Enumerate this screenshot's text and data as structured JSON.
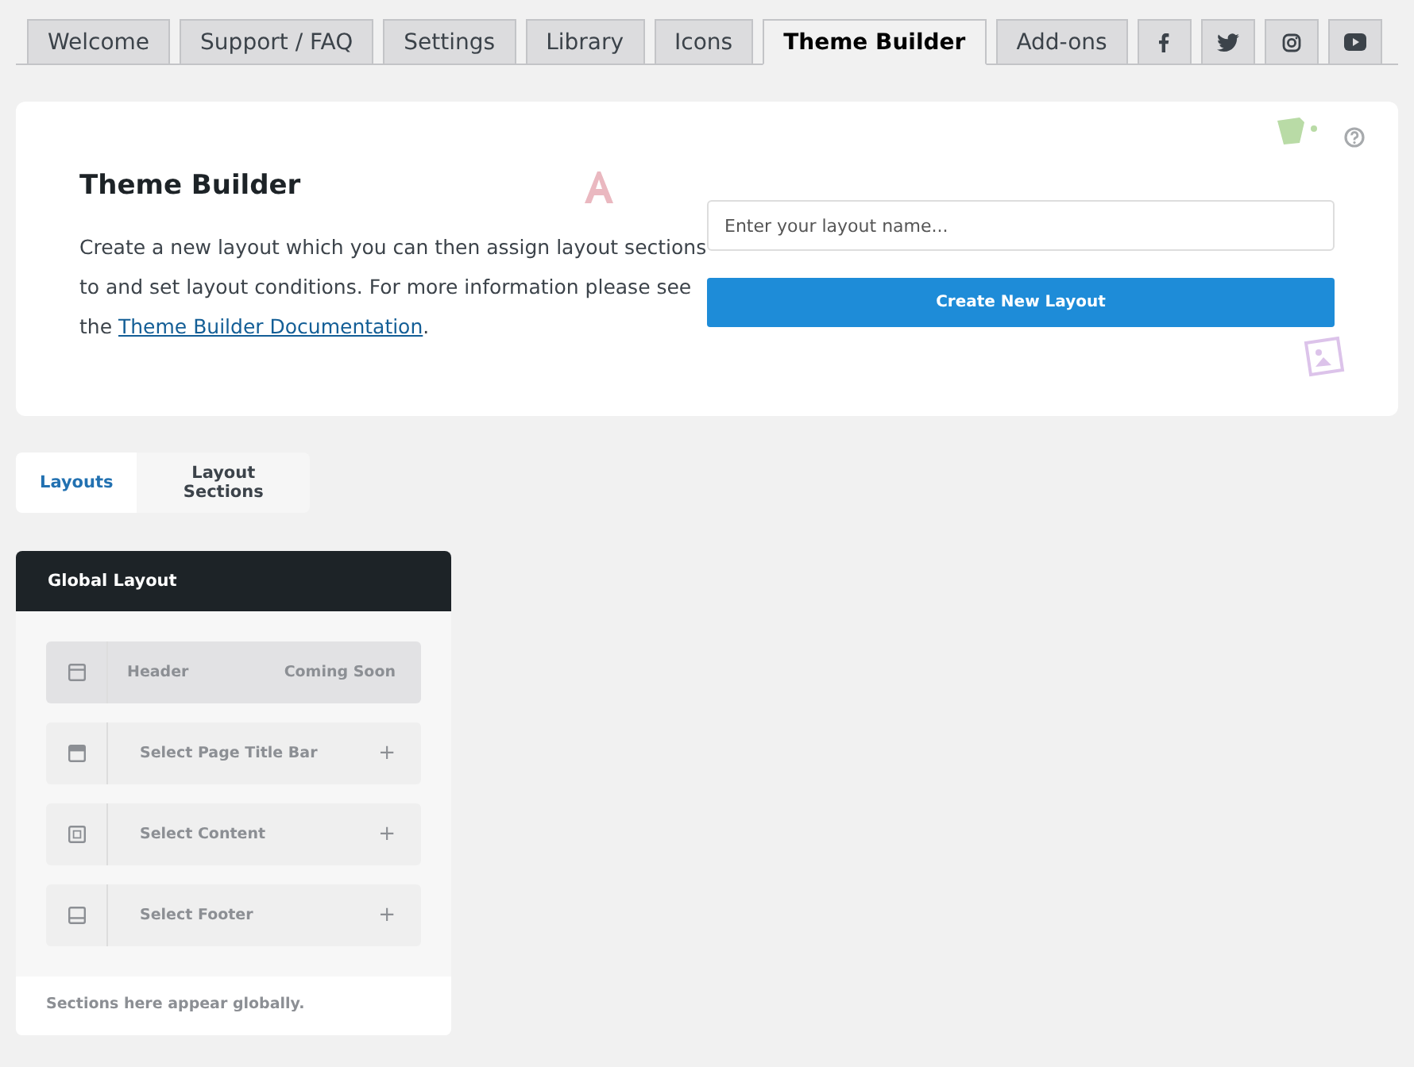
{
  "nav_tabs": [
    {
      "label": "Welcome",
      "selected": false
    },
    {
      "label": "Support / FAQ",
      "selected": false
    },
    {
      "label": "Settings",
      "selected": false
    },
    {
      "label": "Library",
      "selected": false
    },
    {
      "label": "Icons",
      "selected": false
    },
    {
      "label": "Theme Builder",
      "selected": true
    },
    {
      "label": "Add-ons",
      "selected": false
    }
  ],
  "social_tabs": [
    {
      "kind": "facebook"
    },
    {
      "kind": "twitter"
    },
    {
      "kind": "instagram"
    },
    {
      "kind": "youtube"
    }
  ],
  "intro": {
    "title": "Theme Builder",
    "text_before": "Create a new layout which you can then assign layout sections to and set layout conditions. For more information please see the ",
    "link": "Theme Builder Documentation",
    "text_after": "."
  },
  "create_form": {
    "placeholder": "Enter your layout name...",
    "button": "Create New Layout"
  },
  "view_tabs": [
    {
      "label": "Layouts",
      "selected": true
    },
    {
      "label": "Layout Sections",
      "selected": false
    }
  ],
  "global_layout": {
    "title": "Global Layout",
    "sections": [
      {
        "kind": "header",
        "label": "Header",
        "disabled": true,
        "note": "Coming Soon"
      },
      {
        "kind": "title-bar",
        "label": "Select Page Title Bar",
        "disabled": false,
        "action": "+"
      },
      {
        "kind": "content",
        "label": "Select Content",
        "disabled": false,
        "action": "+"
      },
      {
        "kind": "footer",
        "label": "Select Footer",
        "disabled": false,
        "action": "+"
      }
    ],
    "footer": "Sections here appear globally."
  }
}
